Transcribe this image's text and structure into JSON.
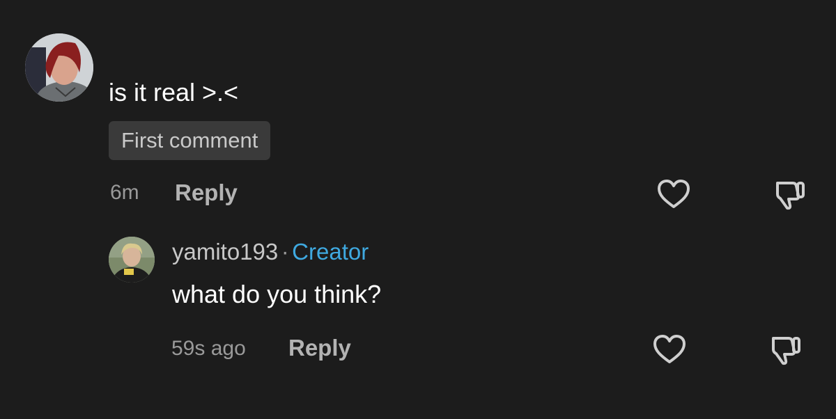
{
  "comment": {
    "text": "is it real >.<",
    "badge": "First comment",
    "time": "6m",
    "reply_label": "Reply"
  },
  "reply": {
    "username": "yamito193",
    "separator": "·",
    "role": "Creator",
    "text": "what do you think?",
    "time": "59s ago",
    "reply_label": "Reply"
  },
  "colors": {
    "background": "#1c1c1c",
    "creator": "#3fa9e0",
    "muted": "#9a9a9a"
  },
  "icons": {
    "like": "heart-icon",
    "dislike": "thumbs-down-icon"
  }
}
